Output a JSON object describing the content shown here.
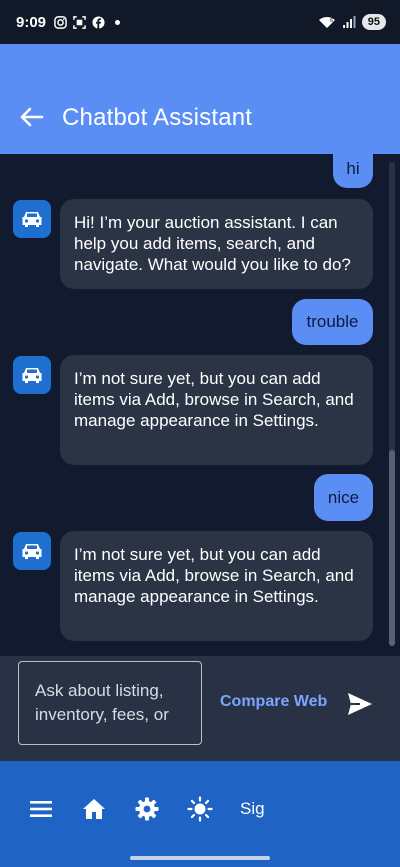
{
  "status_bar": {
    "time": "9:09",
    "battery": "95"
  },
  "app_bar": {
    "title": "Chatbot Assistant"
  },
  "messages": [
    {
      "role": "user",
      "text": "hi"
    },
    {
      "role": "bot",
      "text": "Hi! I’m your auction assistant. I can help you add items, search, and navigate. What would you like to do?"
    },
    {
      "role": "user",
      "text": "trouble"
    },
    {
      "role": "bot",
      "text": "I’m not sure yet, but you can add items via Add, browse in Search, and manage appearance in Settings."
    },
    {
      "role": "user",
      "text": "nice"
    },
    {
      "role": "bot",
      "text": "I’m not sure yet, but you can add items via Add, browse in Search, and manage appearance in Settings."
    }
  ],
  "input": {
    "placeholder": "Ask about listing, inventory, fees, or"
  },
  "compare_button": {
    "label": "Compare Web"
  },
  "bottom_nav": {
    "sign_label": "Sig"
  },
  "colors": {
    "accent": "#5b8ef5",
    "nav": "#1f64c4",
    "bot_bubble": "#2b3445"
  }
}
